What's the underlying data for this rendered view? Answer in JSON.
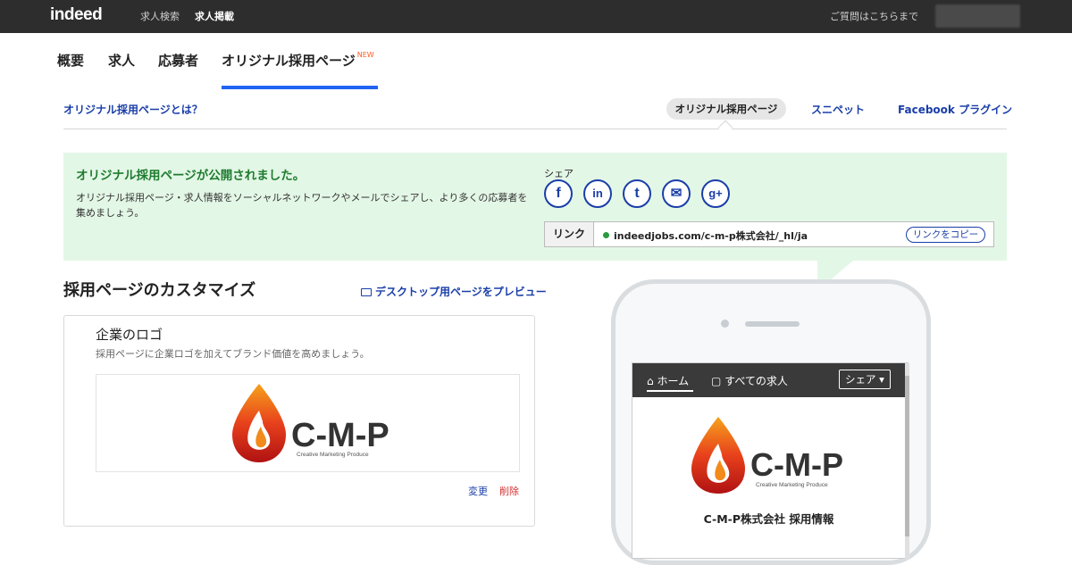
{
  "topbar": {
    "logo": "indeed",
    "nav": [
      "求人検索",
      "求人掲載"
    ],
    "help": "ご質問はこちらまで"
  },
  "tabs": [
    {
      "label": "概要"
    },
    {
      "label": "求人"
    },
    {
      "label": "応募者"
    },
    {
      "label": "オリジナル採用ページ",
      "badge": "NEW",
      "active": true
    }
  ],
  "subnav": {
    "what_is": "オリジナル採用ページとは？",
    "items": [
      "オリジナル採用ページ",
      "スニペット",
      "Facebook プラグイン"
    ],
    "active_index": 0
  },
  "notice": {
    "title": "オリジナル採用ページが公開されました。",
    "body": "オリジナル採用ページ・求人情報をソーシャルネットワークやメールでシェアし、より多くの応募者を集めましょう。",
    "share_label": "シェア",
    "share_icons": [
      {
        "icon": "facebook-icon",
        "glyph": "f"
      },
      {
        "icon": "linkedin-icon",
        "glyph": "in"
      },
      {
        "icon": "twitter-icon",
        "glyph": "t"
      },
      {
        "icon": "mail-icon",
        "glyph": "✉"
      },
      {
        "icon": "google-plus-icon",
        "glyph": "g+"
      }
    ],
    "link_label": "リンク",
    "url": "indeedjobs.com/c-m-p株式会社/_hl/ja",
    "copy_button": "リンクをコピー"
  },
  "customize": {
    "title": "採用ページのカスタマイズ",
    "preview": "デスクトップ用ページをプレビュー",
    "logo_card": {
      "title": "企業のロゴ",
      "subtitle": "採用ページに企業ロゴを加えてブランド価値を高めましょう。",
      "logo_text": "C-M-P",
      "logo_tagline": "Creative Marketing Produce",
      "change": "変更",
      "delete": "削除"
    }
  },
  "phone": {
    "nav": {
      "home": "ホーム",
      "jobs": "すべての求人",
      "share": "シェア ▾"
    },
    "logo_text": "C-M-P",
    "logo_tagline": "Creative Marketing Produce",
    "company": "C-M-P株式会社 採用情報"
  },
  "colors": {
    "link": "#1a3ea8",
    "accent": "#2164f3",
    "notice_bg": "#e3f7e6",
    "notice_title": "#1e7b2e",
    "delete": "#d32f2f"
  }
}
